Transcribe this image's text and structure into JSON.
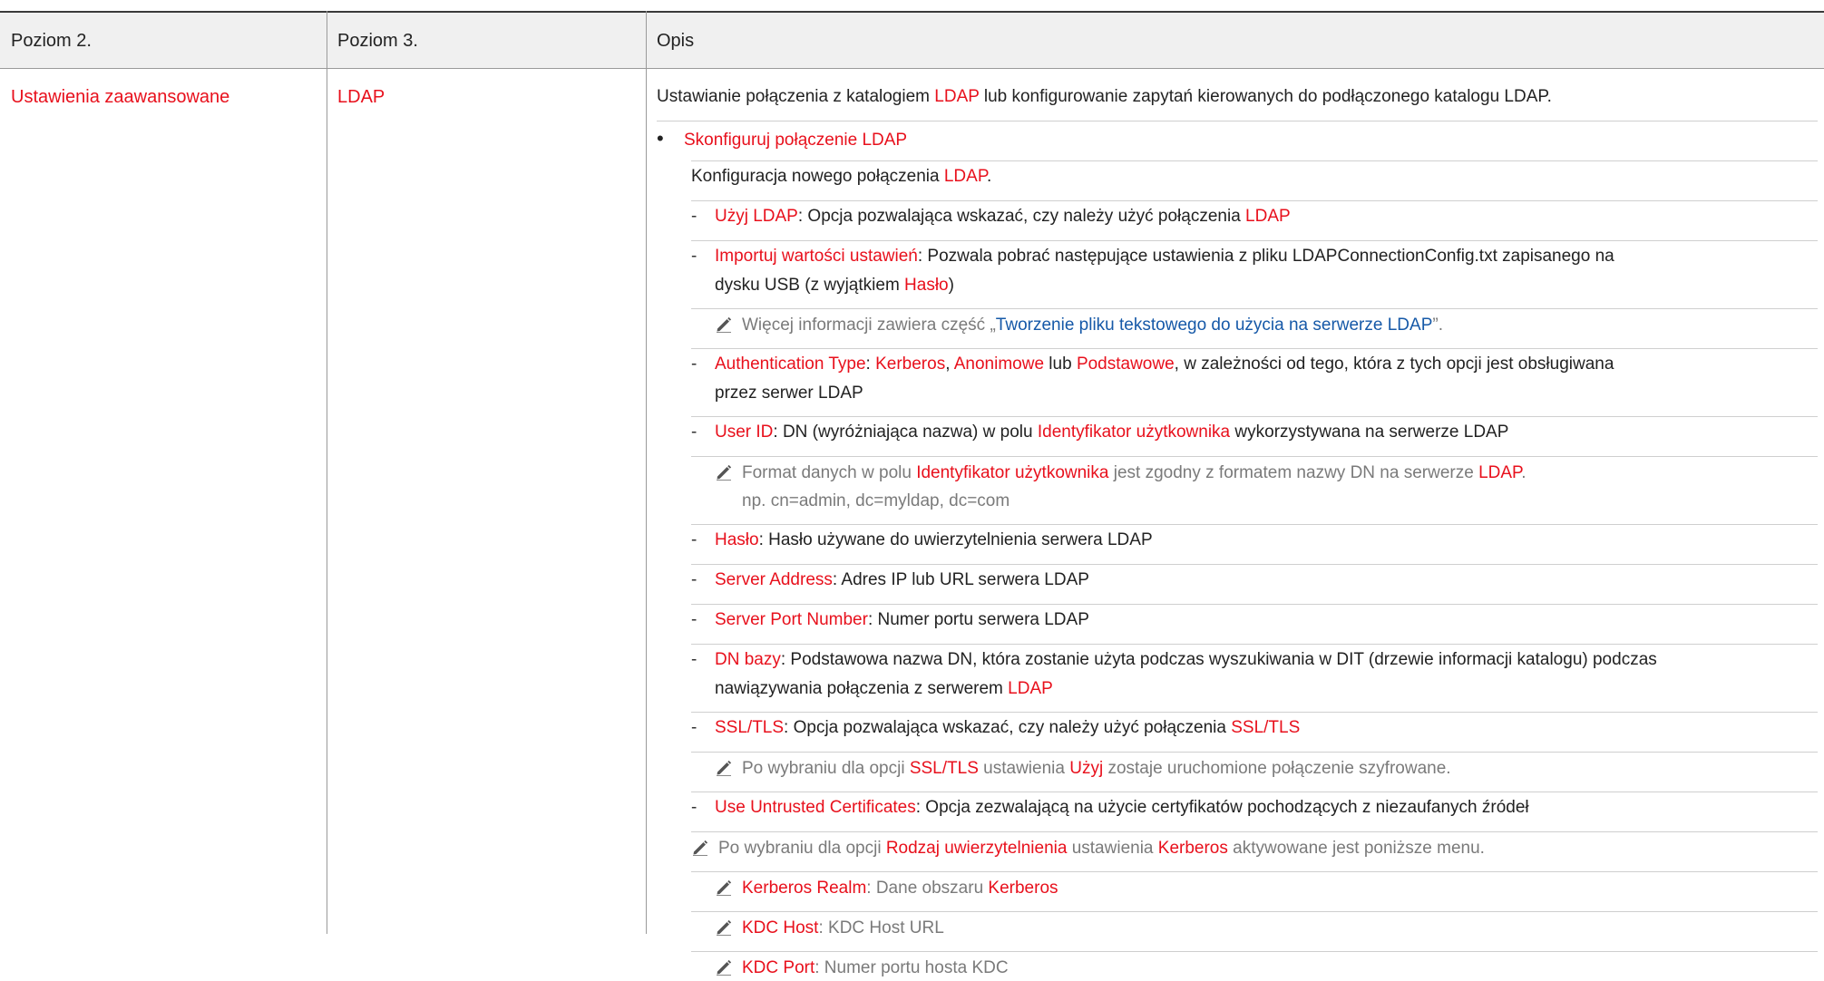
{
  "headers": [
    "Poziom 2.",
    "Poziom 3.",
    "Opis"
  ],
  "level2": "Ustawienia zaawansowane",
  "level3": "LDAP",
  "intro": {
    "a": "Ustawianie połączenia z katalogiem ",
    "b": "LDAP",
    "c": " lub konfigurowanie zapytań kierowanych do podłączonego katalogu LDAP."
  },
  "bullet": "Skonfiguruj połączenie LDAP",
  "config": {
    "a": "Konfiguracja nowego połączenia ",
    "b": "LDAP",
    "c": "."
  },
  "items": {
    "uzyj": {
      "k": "Użyj LDAP",
      "t": ": Opcja pozwalająca wskazać, czy należy użyć połączenia ",
      "r": "LDAP"
    },
    "import": {
      "k": "Importuj wartości ustawień",
      "t1": ": Pozwala pobrać następujące ustawienia z pliku LDAPConnectionConfig.txt zapisanego na",
      "t2a": "dysku USB (z wyjątkiem ",
      "t2b": "Hasło",
      "t2c": ")"
    },
    "import_note": {
      "a": "Więcej informacji zawiera część „",
      "b": "Tworzenie pliku tekstowego do użycia na serwerze LDAP",
      "c": "”."
    },
    "auth": {
      "k": "Authentication Type",
      "s1": ": ",
      "o1": "Kerberos",
      "s2": ", ",
      "o2": "Anonimowe",
      "s3": " lub ",
      "o3": "Podstawowe",
      "t1": ", w zależności od tego, która z tych opcji jest obsługiwana",
      "t2": "przez serwer LDAP"
    },
    "userid": {
      "k": "User ID",
      "a": ": DN (wyróżniająca nazwa) w polu ",
      "b": "Identyfikator użytkownika",
      "c": " wykorzystywana na serwerze LDAP"
    },
    "userid_note": {
      "a": "Format danych w polu ",
      "b": "Identyfikator użytkownika",
      "c": " jest zgodny z formatem nazwy DN na serwerze ",
      "d": "LDAP",
      "e": ".",
      "l2": "np. cn=admin, dc=myldap, dc=com"
    },
    "haslo": {
      "k": "Hasło",
      "t": ": Hasło używane do uwierzytelnienia serwera LDAP"
    },
    "server": {
      "k": "Server Address",
      "t": ": Adres IP lub URL serwera LDAP"
    },
    "port": {
      "k": "Server Port Number",
      "t": ": Numer portu serwera LDAP"
    },
    "dn": {
      "k": "DN bazy",
      "t1": ": Podstawowa nazwa DN, która zostanie użyta podczas wyszukiwania w DIT (drzewie informacji katalogu) podczas",
      "t2a": "nawiązywania połączenia z serwerem ",
      "t2b": "LDAP"
    },
    "ssl": {
      "k": "SSL/TLS",
      "t": ": Opcja pozwalająca wskazać, czy należy użyć połączenia ",
      "r": "SSL/TLS"
    },
    "ssl_note": {
      "a": "Po wybraniu dla opcji ",
      "b": "SSL/TLS",
      "c": " ustawienia ",
      "d": "Użyj",
      "e": " zostaje uruchomione połączenie szyfrowane."
    },
    "untrusted": {
      "k": "Use Untrusted Certificates",
      "t": ": Opcja zezwalającą na użycie certyfikatów pochodzących z niezaufanych źródeł"
    },
    "kerb_note": {
      "a": "Po wybraniu dla opcji ",
      "b": "Rodzaj uwierzytelnienia",
      "c": " ustawienia ",
      "d": "Kerberos",
      "e": " aktywowane jest poniższe menu."
    },
    "realm": {
      "k": "Kerberos Realm",
      "a": ": Dane obszaru ",
      "b": "Kerberos"
    },
    "kdchost": {
      "k": "KDC Host",
      "t": ": KDC Host URL"
    },
    "kdcport": {
      "k": "KDC Port",
      "t": ": Numer portu hosta KDC"
    }
  },
  "colors": {
    "accent": "#e8101c",
    "link": "#1659a8",
    "note": "#7a7a7a"
  }
}
